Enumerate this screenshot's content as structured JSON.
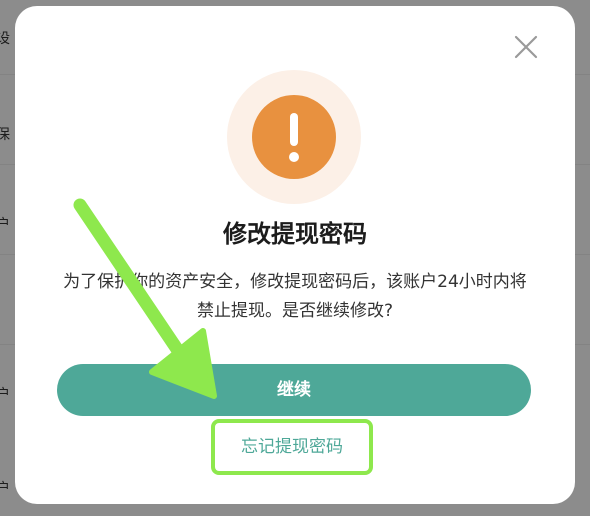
{
  "background": {
    "rows": [
      "设",
      "保",
      "户",
      "户",
      "户"
    ]
  },
  "dialog": {
    "title": "修改提现密码",
    "message": "为了保护你的资产安全，修改提现密码后，该账户24小时内将禁止提现。是否继续修改?",
    "primary_button": "继续",
    "link_button": "忘记提现密码",
    "close_icon": "close-icon",
    "warning_icon": "warning-icon"
  },
  "colors": {
    "accent": "#4ea898",
    "warning": "#e8913f",
    "highlight": "#8ee84d"
  }
}
